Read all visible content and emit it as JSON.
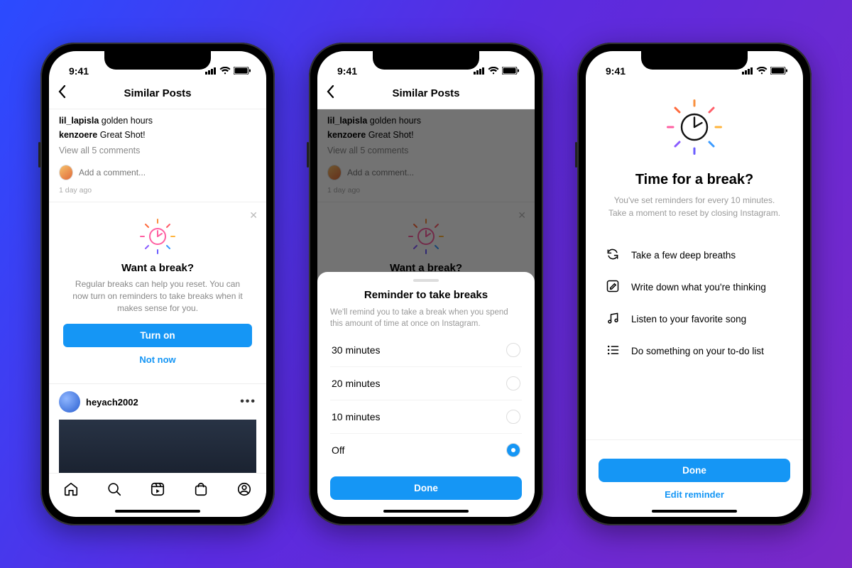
{
  "status": {
    "time": "9:41"
  },
  "colors": {
    "primary": "#1596f5"
  },
  "phone1": {
    "header_title": "Similar Posts",
    "comment1_user": "lil_lapisla",
    "comment1_text": "golden hours",
    "comment2_user": "kenzoere",
    "comment2_text": "Great Shot!",
    "view_all": "View all 5 comments",
    "add_comment_placeholder": "Add a comment...",
    "timestamp": "1 day ago",
    "prompt_title": "Want a break?",
    "prompt_body": "Regular breaks can help you reset. You can now turn on reminders to take breaks when it makes sense for you.",
    "turn_on": "Turn on",
    "not_now": "Not now",
    "next_post_user": "heyach2002",
    "tabs": [
      "home",
      "search",
      "reels",
      "shop",
      "profile"
    ]
  },
  "phone2": {
    "sheet_title": "Reminder to take breaks",
    "sheet_desc": "We'll remind you to take a break when you spend this amount of time at once on Instagram.",
    "options": [
      {
        "label": "30 minutes",
        "selected": false
      },
      {
        "label": "20 minutes",
        "selected": false
      },
      {
        "label": "10 minutes",
        "selected": false
      },
      {
        "label": "Off",
        "selected": true
      }
    ],
    "done": "Done"
  },
  "phone3": {
    "title": "Time for a break?",
    "subtitle": "You've set reminders for every 10 minutes. Take a moment to reset by closing Instagram.",
    "tips": [
      "Take a few deep breaths",
      "Write down what you're thinking",
      "Listen to your favorite song",
      "Do something on your to-do list"
    ],
    "done": "Done",
    "edit": "Edit reminder"
  }
}
